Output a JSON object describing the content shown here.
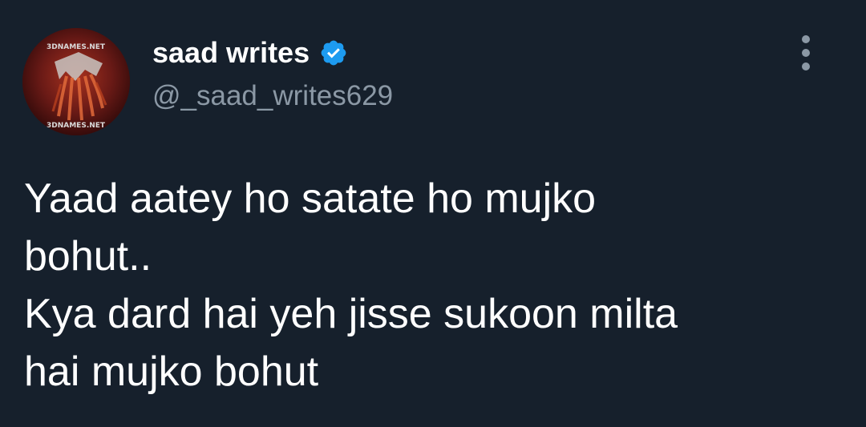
{
  "tweet": {
    "author": {
      "display_name": "saad writes",
      "handle": "@_saad_writes629",
      "verified": true,
      "avatar_icon": "avatar-image",
      "avatar_watermark_top": "3DNAMES.NET",
      "avatar_watermark_bottom": "3DNAMES.NET"
    },
    "text": "Yaad aatey ho satate ho mujko\nbohut..\nKya dard hai yeh jisse sukoon milta\nhai mujko bohut",
    "more_icon": "more-vertical-icon",
    "verified_icon": "verified-badge-icon"
  },
  "colors": {
    "background": "#16202c",
    "text_primary": "#ffffff",
    "text_secondary": "#8b98a5",
    "verified": "#1d9bf0"
  }
}
